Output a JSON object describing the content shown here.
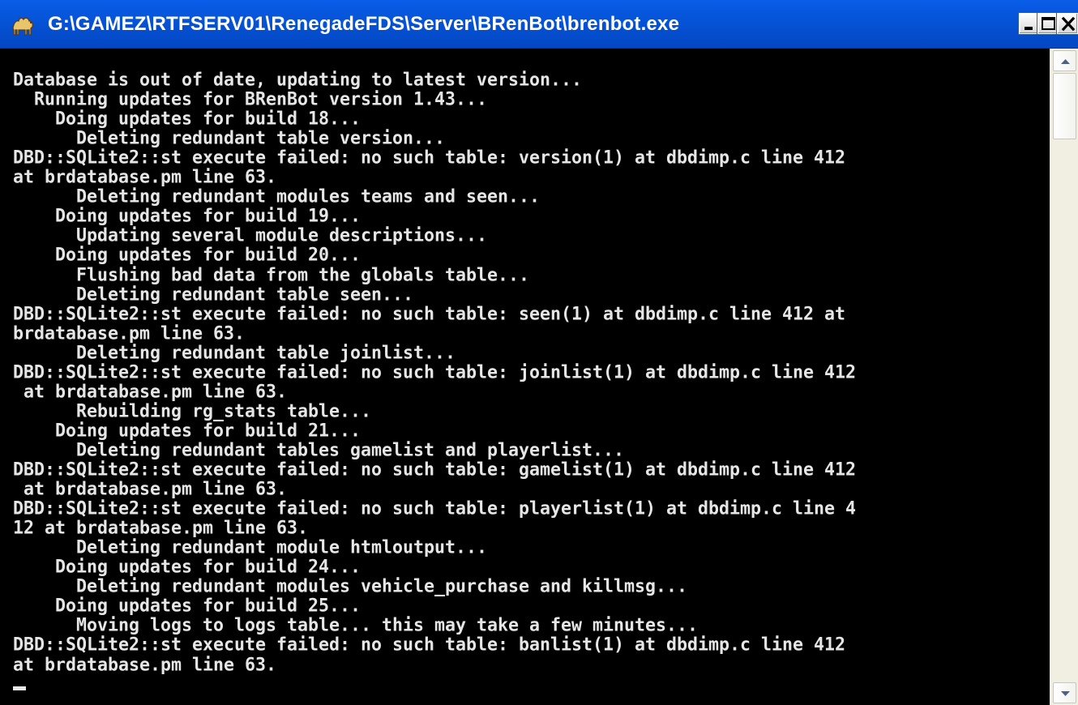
{
  "window": {
    "title": "G:\\GAMEZ\\RTFSERV01\\RenegadeFDS\\Server\\BRenBot\\brenbot.exe",
    "icon": "camel-perl-icon",
    "title_color": "#ffffff",
    "titlebar_color": "#0553d6",
    "close_glyph": "×"
  },
  "console": {
    "background": "#000000",
    "text_color": "#e6e6e6",
    "lines": [
      "Database is out of date, updating to latest version...",
      "  Running updates for BRenBot version 1.43...",
      "    Doing updates for build 18...",
      "      Deleting redundant table version...",
      "DBD::SQLite2::st execute failed: no such table: version(1) at dbdimp.c line 412",
      "at brdatabase.pm line 63.",
      "      Deleting redundant modules teams and seen...",
      "    Doing updates for build 19...",
      "      Updating several module descriptions...",
      "    Doing updates for build 20...",
      "      Flushing bad data from the globals table...",
      "      Deleting redundant table seen...",
      "DBD::SQLite2::st execute failed: no such table: seen(1) at dbdimp.c line 412 at",
      "brdatabase.pm line 63.",
      "      Deleting redundant table joinlist...",
      "DBD::SQLite2::st execute failed: no such table: joinlist(1) at dbdimp.c line 412",
      " at brdatabase.pm line 63.",
      "      Rebuilding rg_stats table...",
      "    Doing updates for build 21...",
      "      Deleting redundant tables gamelist and playerlist...",
      "DBD::SQLite2::st execute failed: no such table: gamelist(1) at dbdimp.c line 412",
      " at brdatabase.pm line 63.",
      "DBD::SQLite2::st execute failed: no such table: playerlist(1) at dbdimp.c line 4",
      "12 at brdatabase.pm line 63.",
      "      Deleting redundant module htmloutput...",
      "    Doing updates for build 24...",
      "      Deleting redundant modules vehicle_purchase and killmsg...",
      "    Doing updates for build 25...",
      "      Moving logs to logs table... this may take a few minutes...",
      "DBD::SQLite2::st execute failed: no such table: banlist(1) at dbdimp.c line 412",
      "at brdatabase.pm line 63."
    ]
  },
  "scrollbar": {
    "up_icon": "arrow-up-icon",
    "down_icon": "arrow-down-icon",
    "track_color": "#f1efe2"
  }
}
